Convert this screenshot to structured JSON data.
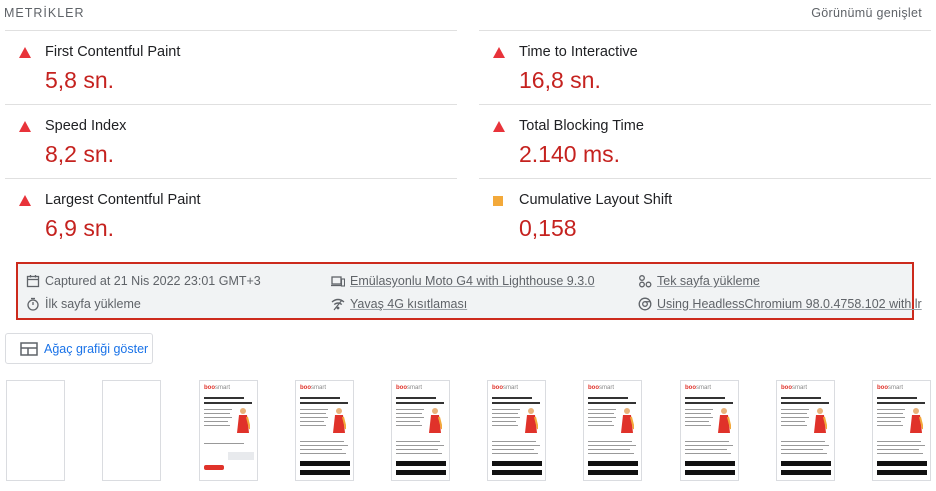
{
  "header": {
    "title": "METRİKLER",
    "expand_label": "Görünümü genişlet"
  },
  "metrics": [
    {
      "label": "First Contentful Paint",
      "value": "5,8 sn.",
      "status": "fail",
      "indicator_color": "#e8333a"
    },
    {
      "label": "Time to Interactive",
      "value": "16,8 sn.",
      "status": "fail",
      "indicator_color": "#e8333a"
    },
    {
      "label": "Speed Index",
      "value": "8,2 sn.",
      "status": "fail",
      "indicator_color": "#e8333a"
    },
    {
      "label": "Total Blocking Time",
      "value": "2.140 ms.",
      "status": "fail",
      "indicator_color": "#e8333a"
    },
    {
      "label": "Largest Contentful Paint",
      "value": "6,9 sn.",
      "status": "fail",
      "indicator_color": "#e8333a"
    },
    {
      "label": "Cumulative Layout Shift",
      "value": "0,158",
      "status": "average",
      "indicator_color": "#f3a93a"
    }
  ],
  "summary": {
    "captured": "Captured at 21 Nis 2022 23:01 GMT+3",
    "emulation": "Emülasyonlu Moto G4 with Lighthouse 9.3.0",
    "single_page": "Tek sayfa yükleme",
    "initial_load": "İlk sayfa yükleme",
    "throttling": "Yavaş 4G kısıtlaması",
    "browser": "Using HeadlessChromium 98.0.4758.102 with lr"
  },
  "tree_button": {
    "label": "Ağaç grafiği göster",
    "icon": "treemap-icon"
  },
  "filmstrip": {
    "frame_count": 10,
    "logo_text_a": "boo",
    "logo_text_b": "smart"
  },
  "colors": {
    "fail": "#e8333a",
    "average": "#f3a93a",
    "value": "#c5221f",
    "highlight_border": "#cc2a1c",
    "link": "#1a73e8"
  }
}
